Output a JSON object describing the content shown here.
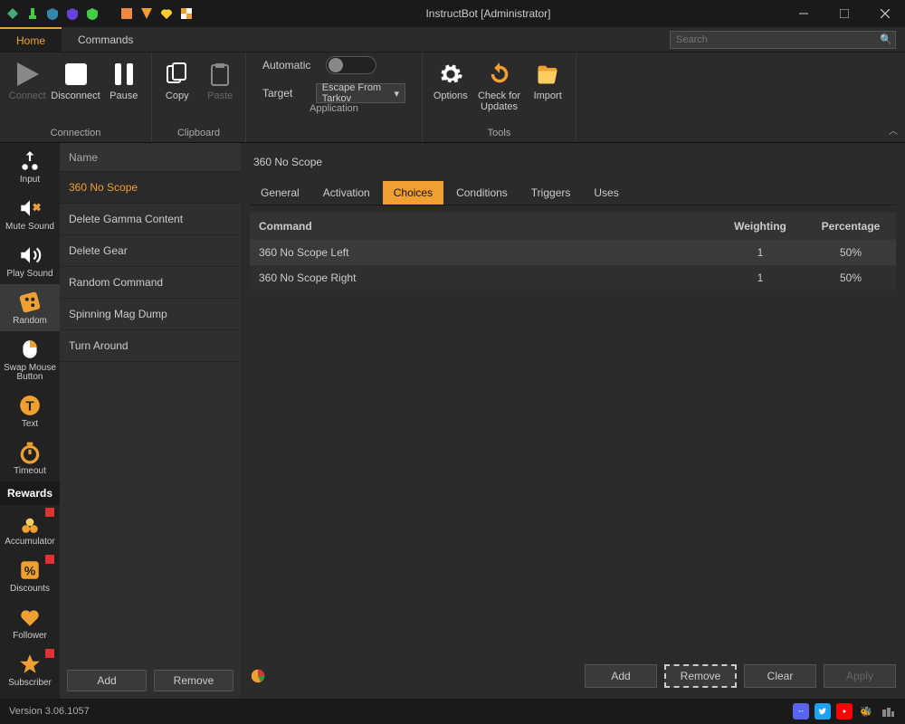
{
  "window": {
    "title": "InstructBot [Administrator]"
  },
  "menu": {
    "tabs": [
      "Home",
      "Commands"
    ],
    "active": "Home",
    "search_placeholder": "Search"
  },
  "ribbon": {
    "connection": {
      "label": "Connection",
      "connect": "Connect",
      "disconnect": "Disconnect",
      "pause": "Pause"
    },
    "clipboard": {
      "label": "Clipboard",
      "copy": "Copy",
      "paste": "Paste"
    },
    "application": {
      "label": "Application",
      "automatic": "Automatic",
      "target": "Target",
      "target_value": "Escape From Tarkov"
    },
    "tools": {
      "label": "Tools",
      "options": "Options",
      "updates": "Check for Updates",
      "import": "Import"
    }
  },
  "sidebar": {
    "items": [
      {
        "label": "Input",
        "icon": "input"
      },
      {
        "label": "Mute Sound",
        "icon": "mute"
      },
      {
        "label": "Play Sound",
        "icon": "play"
      },
      {
        "label": "Random",
        "icon": "dice",
        "active": true
      },
      {
        "label": "Swap Mouse Button",
        "icon": "mouse"
      },
      {
        "label": "Text",
        "icon": "text"
      },
      {
        "label": "Timeout",
        "icon": "timer"
      }
    ],
    "rewards_header": "Rewards",
    "rewards": [
      {
        "label": "Accumulator",
        "icon": "accum",
        "badge": true
      },
      {
        "label": "Discounts",
        "icon": "discount",
        "badge": true
      },
      {
        "label": "Follower",
        "icon": "heart"
      },
      {
        "label": "Subscriber",
        "icon": "star",
        "badge": true
      }
    ]
  },
  "commands": {
    "header": "Name",
    "items": [
      "360 No Scope",
      "Delete Gamma Content",
      "Delete Gear",
      "Random Command",
      "Spinning Mag Dump",
      "Turn Around"
    ],
    "active": "360 No Scope",
    "add": "Add",
    "remove": "Remove"
  },
  "detail": {
    "title": "360 No Scope",
    "tabs": [
      "General",
      "Activation",
      "Choices",
      "Conditions",
      "Triggers",
      "Uses"
    ],
    "active_tab": "Choices",
    "table": {
      "headers": {
        "command": "Command",
        "weighting": "Weighting",
        "percentage": "Percentage"
      },
      "rows": [
        {
          "command": "360 No Scope Left",
          "weighting": "1",
          "percentage": "50%"
        },
        {
          "command": "360 No Scope Right",
          "weighting": "1",
          "percentage": "50%"
        }
      ]
    },
    "footer": {
      "add": "Add",
      "remove": "Remove",
      "clear": "Clear",
      "apply": "Apply"
    }
  },
  "status": {
    "version": "Version 3.06.1057"
  }
}
